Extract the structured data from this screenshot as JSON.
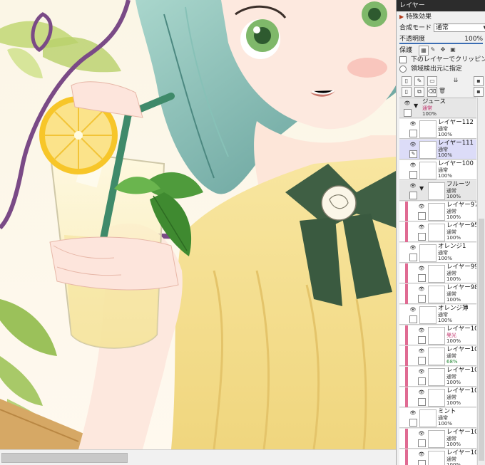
{
  "panel": {
    "title": "レイヤー",
    "special_effects": "特殊効果",
    "blend_label": "合成モード",
    "blend_value": "通常",
    "opacity_label": "不透明度",
    "opacity_value": "100%",
    "protect_label": "保護",
    "clip_label": "下のレイヤーでクリッピング",
    "source_label": "領域検出元に指定"
  },
  "layers": [
    {
      "name": "ジュース",
      "mode": "通常",
      "opacity": "100%",
      "folder": true,
      "clip": false,
      "indent": 0,
      "mode_color": "#c0306a"
    },
    {
      "name": "レイヤー112",
      "mode": "通常",
      "opacity": "100%",
      "folder": false,
      "clip": false,
      "indent": 1
    },
    {
      "name": "レイヤー111",
      "mode": "通常",
      "opacity": "100%",
      "folder": false,
      "clip": false,
      "indent": 1,
      "selected": true
    },
    {
      "name": "レイヤー100",
      "mode": "通常",
      "opacity": "100%",
      "folder": false,
      "clip": false,
      "indent": 1
    },
    {
      "name": "フルーツ",
      "mode": "通常",
      "opacity": "100%",
      "folder": true,
      "clip": false,
      "indent": 1
    },
    {
      "name": "レイヤー97",
      "mode": "通常",
      "opacity": "100%",
      "folder": false,
      "clip": true,
      "indent": 2
    },
    {
      "name": "レイヤー95",
      "mode": "通常",
      "opacity": "100%",
      "folder": false,
      "clip": true,
      "indent": 2
    },
    {
      "name": "オレンジ1",
      "mode": "通常",
      "opacity": "100%",
      "folder": false,
      "clip": false,
      "indent": 1
    },
    {
      "name": "レイヤー99",
      "mode": "通常",
      "opacity": "100%",
      "folder": false,
      "clip": true,
      "indent": 2
    },
    {
      "name": "レイヤー98",
      "mode": "通常",
      "opacity": "100%",
      "folder": false,
      "clip": true,
      "indent": 2
    },
    {
      "name": "オレンジ薄",
      "mode": "通常",
      "opacity": "100%",
      "folder": false,
      "clip": false,
      "indent": 1
    },
    {
      "name": "レイヤー104",
      "mode": "発光",
      "opacity": "100%",
      "folder": false,
      "clip": true,
      "indent": 2,
      "mode_color": "#c0306a"
    },
    {
      "name": "レイヤー103",
      "mode": "通常",
      "opacity": "68%",
      "folder": false,
      "clip": true,
      "indent": 2,
      "op_color": "#2a8a3a"
    },
    {
      "name": "レイヤー101",
      "mode": "通常",
      "opacity": "100%",
      "folder": false,
      "clip": true,
      "indent": 2
    },
    {
      "name": "レイヤー102",
      "mode": "通常",
      "opacity": "100%",
      "folder": false,
      "clip": true,
      "indent": 2
    },
    {
      "name": "ミント",
      "mode": "通常",
      "opacity": "100%",
      "folder": false,
      "clip": false,
      "indent": 1
    },
    {
      "name": "レイヤー106",
      "mode": "通常",
      "opacity": "100%",
      "folder": false,
      "clip": true,
      "indent": 2
    },
    {
      "name": "レイヤー105",
      "mode": "通常",
      "opacity": "100%",
      "folder": false,
      "clip": true,
      "indent": 2
    }
  ],
  "icons": {
    "protect": [
      "checker-icon",
      "pen-lock-icon",
      "move-lock-icon",
      "lock-icon"
    ],
    "toolbar1": [
      "new-layer-icon",
      "new-vector-layer-icon",
      "new-folder-icon",
      "merge-icon"
    ],
    "toolbar2": [
      "new-layer-set-icon",
      "copy-layer-icon",
      "clear-layer-icon",
      "delete-layer-icon"
    ]
  }
}
